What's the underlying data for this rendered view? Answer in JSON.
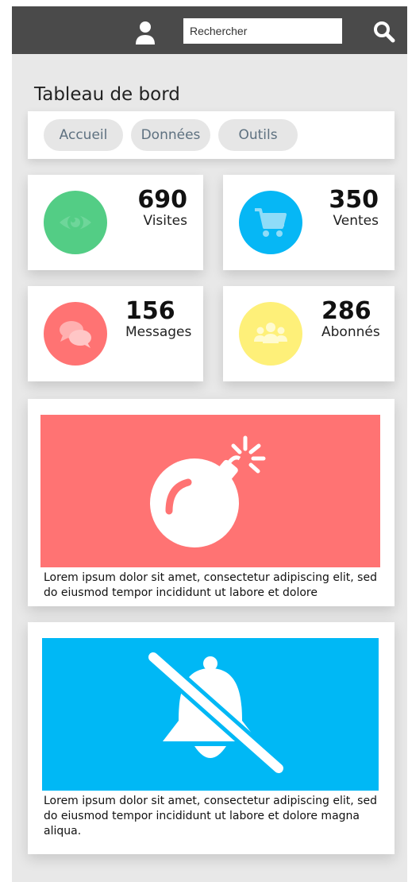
{
  "header": {
    "search_placeholder": "Rechercher"
  },
  "page": {
    "title": "Tableau de bord"
  },
  "tabs": [
    {
      "label": "Accueil"
    },
    {
      "label": "Données"
    },
    {
      "label": "Outils"
    }
  ],
  "stats": [
    {
      "value": "690",
      "label": "Visites",
      "icon": "eye-icon",
      "color": "#53cd85"
    },
    {
      "value": "350",
      "label": "Ventes",
      "icon": "cart-icon",
      "color": "#06b7f5"
    },
    {
      "value": "156",
      "label": "Messages",
      "icon": "chat-icon",
      "color": "#ff7373"
    },
    {
      "value": "286",
      "label": "Abonnés",
      "icon": "users-icon",
      "color": "#fef079"
    }
  ],
  "cards": [
    {
      "icon": "bomb-icon",
      "color": "#ff7373",
      "text": "Lorem ipsum dolor sit amet, consectetur adipiscing elit, sed do eiusmod tempor incididunt ut labore et dolore"
    },
    {
      "icon": "bell-slash-icon",
      "color": "#00b8f5",
      "text": "Lorem ipsum dolor sit amet, consectetur adipiscing elit, sed do eiusmod tempor incididunt ut labore et dolore magna aliqua."
    }
  ],
  "colors": {
    "topbar": "#4a4a4a",
    "background": "#e8e8e8",
    "tab_text": "#5e7180"
  }
}
